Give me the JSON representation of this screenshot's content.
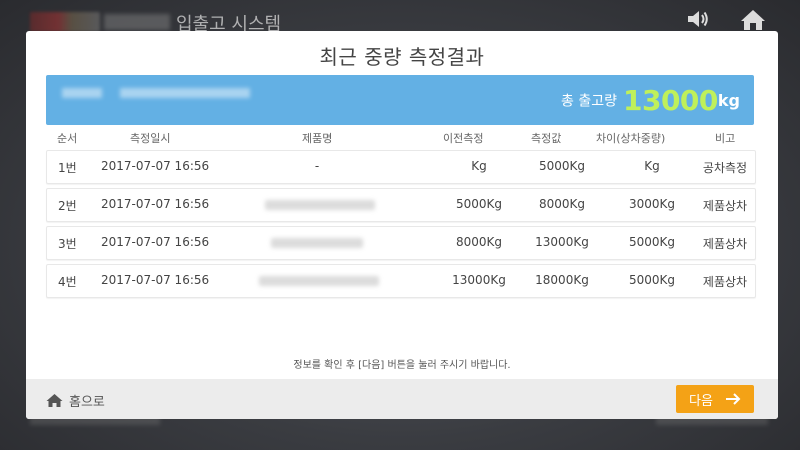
{
  "app": {
    "title": "입출고 시스템",
    "icons": [
      "volume-icon",
      "home-icon"
    ]
  },
  "dialog": {
    "title": "최근 중량 측정결과",
    "summary": {
      "label": "총 출고량",
      "value": "13000",
      "unit": "kg"
    },
    "columns": [
      "순서",
      "측정일시",
      "제품명",
      "이전측정",
      "측정값",
      "차이(상차중량)",
      "비고"
    ],
    "rows": [
      {
        "seq": "1번",
        "datetime": "2017-07-07 16:56",
        "product": "-",
        "prev": "Kg",
        "measured": "5000Kg",
        "diff": "Kg",
        "note": "공차측정"
      },
      {
        "seq": "2번",
        "datetime": "2017-07-07 16:56",
        "product": "",
        "prev": "5000Kg",
        "measured": "8000Kg",
        "diff": "3000Kg",
        "note": "제품상차"
      },
      {
        "seq": "3번",
        "datetime": "2017-07-07 16:56",
        "product": "",
        "prev": "8000Kg",
        "measured": "13000Kg",
        "diff": "5000Kg",
        "note": "제품상차"
      },
      {
        "seq": "4번",
        "datetime": "2017-07-07 16:56",
        "product": "",
        "prev": "13000Kg",
        "measured": "18000Kg",
        "diff": "5000Kg",
        "note": "제품상차"
      }
    ],
    "info_text": "정보를 확인 후 [다음] 버튼을 눌러 주시기 바랍니다.",
    "footer": {
      "home_label": "홈으로",
      "next_label": "다음"
    },
    "colors": {
      "summary_bg": "#63b0e4",
      "total_value": "#bff05a",
      "next_button": "#f4a216"
    }
  }
}
